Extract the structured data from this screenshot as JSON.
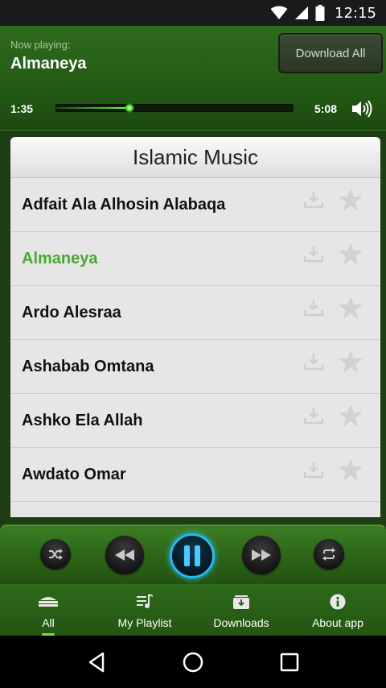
{
  "status_bar": {
    "time": "12:15"
  },
  "header": {
    "now_playing_label": "Now playing:",
    "track_title": "Almaneya",
    "download_all_label": "Download All",
    "current_time": "1:35",
    "total_time": "5:08",
    "progress_fraction": 0.31
  },
  "playlist": {
    "title": "Islamic Music",
    "active_index": 1,
    "items": [
      {
        "title": "Adfait Ala Alhosin Alabaqa"
      },
      {
        "title": "Almaneya"
      },
      {
        "title": "Ardo Alesraa"
      },
      {
        "title": "Ashabab Omtana"
      },
      {
        "title": "Ashko Ela Allah"
      },
      {
        "title": "Awdato Omar"
      }
    ]
  },
  "controls": {
    "shuffle_icon": "shuffle-icon",
    "rewind_icon": "rewind-icon",
    "pause_icon": "pause-icon",
    "forward_icon": "fast-forward-icon",
    "repeat_icon": "repeat-icon"
  },
  "tabs": [
    {
      "label": "All",
      "icon": "all-music-icon"
    },
    {
      "label": "My Playlist",
      "icon": "playlist-icon"
    },
    {
      "label": "Downloads",
      "icon": "downloads-icon"
    },
    {
      "label": "About app",
      "icon": "info-icon"
    }
  ],
  "colors": {
    "accent_green": "#4aa836",
    "header_green": "#2f6b1d",
    "pause_blue": "#27b8f0"
  }
}
